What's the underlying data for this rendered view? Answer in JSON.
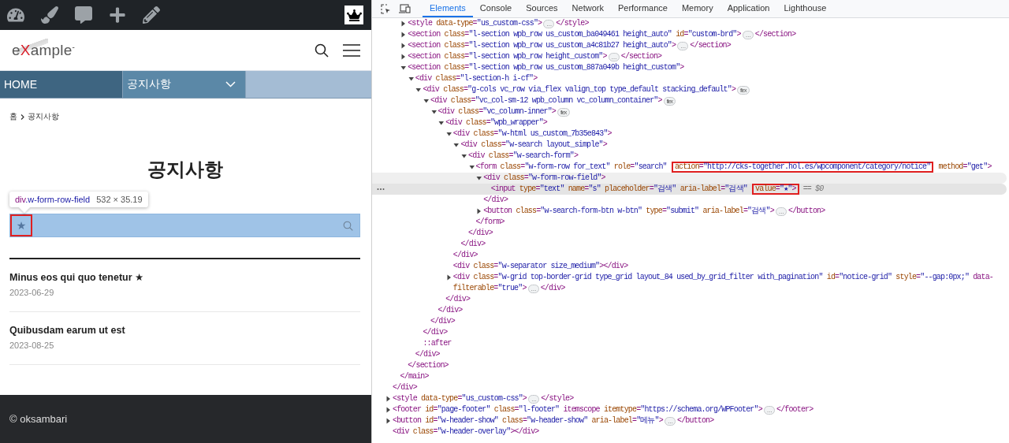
{
  "site": {
    "logo": {
      "before": "e",
      "accent": "X",
      "after": "ample",
      "mark": "-"
    },
    "nav": [
      {
        "label": "HOME",
        "color": "#3e6581",
        "dropdown": false
      },
      {
        "label": "공지사항",
        "color": "#5b88a7",
        "dropdown": true
      }
    ],
    "breadcrumb": [
      "홈",
      "공지사항"
    ],
    "title": "공지사항",
    "inspector_tooltip": {
      "selector": "div.w-form-row-field",
      "size": "532 × 35.19"
    },
    "search": {
      "value": "★",
      "highlighted": true
    },
    "posts": [
      {
        "title": "Minus eos qui quo tenetur ★",
        "date": "2023-06-29"
      },
      {
        "title": "Quibusdam earum ut est",
        "date": "2023-08-25"
      }
    ],
    "footer": "© oksambari"
  },
  "devtools": {
    "tabs": [
      {
        "label": "Elements",
        "selected": true
      },
      {
        "label": "Console",
        "selected": false
      },
      {
        "label": "Sources",
        "selected": false
      },
      {
        "label": "Network",
        "selected": false
      },
      {
        "label": "Performance",
        "selected": false
      },
      {
        "label": "Memory",
        "selected": false
      },
      {
        "label": "Application",
        "selected": false
      },
      {
        "label": "Lighthouse",
        "selected": false
      }
    ],
    "tree": [
      {
        "close": "</div>",
        "children": [
          {
            "close": "</main>",
            "children": [
              {
                "expanded": false,
                "selected": false,
                "hovered": false,
                "open": [
                  {
                    "text": "<style data-type=\"us_custom-css\">",
                    "boxed": false
                  }
                ],
                "badge": "…",
                "close": "</style>"
              },
              {
                "expanded": false,
                "selected": false,
                "hovered": false,
                "open": [
                  {
                    "text": "<section class=\"l-section wpb_row us_custom_ba049461 height_auto\" id=\"custom-brd\">",
                    "boxed": false
                  }
                ],
                "badge": "…",
                "close": "</section>"
              },
              {
                "expanded": false,
                "selected": false,
                "hovered": false,
                "open": [
                  {
                    "text": "<section class=\"l-section wpb_row us_custom_a4c81b27 height_auto\">",
                    "boxed": false
                  }
                ],
                "badge": "…",
                "close": "</section>"
              },
              {
                "expanded": false,
                "selected": false,
                "hovered": false,
                "open": [
                  {
                    "text": "<section class=\"l-section wpb_row height_custom\">",
                    "boxed": false
                  }
                ],
                "badge": "…",
                "close": "</section>"
              },
              {
                "expanded": true,
                "selected": false,
                "hovered": false,
                "open": [
                  {
                    "text": "<section class=\"l-section wpb_row us_custom_887a049b height_custom\">",
                    "boxed": false
                  }
                ],
                "close": "</section>",
                "children": [
                  {
                    "expanded": true,
                    "selected": false,
                    "hovered": false,
                    "open": [
                      {
                        "text": "<div class=\"l-section-h i-cf\">",
                        "boxed": false
                      }
                    ],
                    "close": "</div>",
                    "children": [
                      {
                        "expanded": true,
                        "selected": false,
                        "hovered": false,
                        "open": [
                          {
                            "text": "<div class=\"g-cols vc_row via_flex valign_top type_default stacking_default\">",
                            "boxed": false
                          }
                        ],
                        "badge": "flex",
                        "close": "</div>",
                        "children": [
                          {
                            "expanded": true,
                            "selected": false,
                            "hovered": false,
                            "open": [
                              {
                                "text": "<div class=\"vc_col-sm-12 wpb_column vc_column_container\">",
                                "boxed": false
                              }
                            ],
                            "badge": "flex",
                            "close": "</div>",
                            "children": [
                              {
                                "expanded": true,
                                "selected": false,
                                "hovered": false,
                                "open": [
                                  {
                                    "text": "<div class=\"vc_column-inner\">",
                                    "boxed": false
                                  }
                                ],
                                "badge": "flex",
                                "close": "</div>",
                                "children": [
                                  {
                                    "expanded": true,
                                    "selected": false,
                                    "hovered": false,
                                    "open": [
                                      {
                                        "text": "<div class=\"wpb_wrapper\">",
                                        "boxed": false
                                      }
                                    ],
                                    "close": "</div>",
                                    "children": [
                                      {
                                        "expanded": true,
                                        "selected": false,
                                        "hovered": false,
                                        "open": [
                                          {
                                            "text": "<div class=\"w-html us_custom_7b35e843\">",
                                            "boxed": false
                                          }
                                        ],
                                        "close": "</div>",
                                        "children": [
                                          {
                                            "expanded": true,
                                            "selected": false,
                                            "hovered": false,
                                            "open": [
                                              {
                                                "text": "<div class=\"w-search layout_simple\">",
                                                "boxed": false
                                              }
                                            ],
                                            "close": "</div>",
                                            "children": [
                                              {
                                                "expanded": true,
                                                "selected": false,
                                                "hovered": false,
                                                "open": [
                                                  {
                                                    "text": "<div class=\"w-search-form\">",
                                                    "boxed": false
                                                  }
                                                ],
                                                "close": "</div>",
                                                "children": [
                                                  {
                                                    "expanded": true,
                                                    "selected": false,
                                                    "hovered": false,
                                                    "open": [
                                                      {
                                                        "text": "<form class=\"w-form-row for_text\" role=\"search\" ",
                                                        "boxed": false
                                                      },
                                                      {
                                                        "text": "action=\"http://cks-together.hol.es/wpcomponent/category/notice\"",
                                                        "boxed": true
                                                      },
                                                      {
                                                        "text": " method=\"get\">",
                                                        "boxed": false
                                                      }
                                                    ],
                                                    "close": "</form>",
                                                    "children": [
                                                      {
                                                        "expanded": true,
                                                        "selected": false,
                                                        "hovered": true,
                                                        "open": [
                                                          {
                                                            "text": "<div class=\"w-form-row-field\">",
                                                            "boxed": false
                                                          }
                                                        ],
                                                        "close": "</div>",
                                                        "children": [
                                                          {
                                                            "selected": true,
                                                            "hovered": false,
                                                            "open": [
                                                              {
                                                                "text": "<input type=\"text\" name=\"s\" placeholder=\"검색\" aria-label=\"검색\" ",
                                                                "boxed": false
                                                              },
                                                              {
                                                                "text": "value=\"★\">",
                                                                "boxed": true
                                                              }
                                                            ],
                                                            "console_ref": "== $0"
                                                          }
                                                        ]
                                                      },
                                                      {
                                                        "expanded": false,
                                                        "selected": false,
                                                        "hovered": false,
                                                        "open": [
                                                          {
                                                            "text": "<button class=\"w-search-form-btn w-btn\" type=\"submit\" aria-label=\"검색\">",
                                                            "boxed": false
                                                          }
                                                        ],
                                                        "badge": "…",
                                                        "close": "</button>"
                                                      }
                                                    ]
                                                  }
                                                ]
                                              }
                                            ]
                                          }
                                        ]
                                      },
                                      {
                                        "selected": false,
                                        "hovered": false,
                                        "open": [
                                          {
                                            "text": "<div class=\"w-separator size_medium\">",
                                            "boxed": false
                                          }
                                        ],
                                        "close": "</div>"
                                      },
                                      {
                                        "expanded": false,
                                        "selected": false,
                                        "hovered": false,
                                        "open": [
                                          {
                                            "text": "<div class=\"w-grid top-border-grid type_grid layout_84 used_by_grid_filter with_pagination\" id=\"notice-grid\" style=\"--gap:0px;\" data-",
                                            "boxed": false
                                          },
                                          {
                                            "text": "filterable=\"true\">",
                                            "boxed": false
                                          }
                                        ],
                                        "badge": "…",
                                        "close": "</div>"
                                      }
                                    ]
                                  }
                                ]
                              }
                            ]
                          }
                        ]
                      },
                      {
                        "selected": false,
                        "hovered": false,
                        "open": [
                          {
                            "text": "::after",
                            "boxed": false
                          }
                        ]
                      }
                    ]
                  }
                ]
              }
            ]
          }
        ]
      },
      {
        "expanded": false,
        "selected": false,
        "hovered": false,
        "open": [
          {
            "text": "<style data-type=\"us_custom-css\">",
            "boxed": false
          }
        ],
        "badge": "…",
        "close": "</style>"
      },
      {
        "expanded": false,
        "selected": false,
        "hovered": false,
        "open": [
          {
            "text": "<footer id=\"page-footer\" class=\"l-footer\" itemscope itemtype=\"https://schema.org/WPFooter\">",
            "boxed": false
          }
        ],
        "badge": "…",
        "close": "</footer>"
      },
      {
        "expanded": false,
        "selected": false,
        "hovered": false,
        "open": [
          {
            "text": "<button id=\"w-header-show\" class=\"w-header-show\" aria-label=\"메뉴\">",
            "boxed": false
          }
        ],
        "badge": "…",
        "close": "</button>"
      },
      {
        "selected": false,
        "hovered": false,
        "open": [
          {
            "text": "<div class=\"w-header-overlay\">",
            "boxed": false
          }
        ],
        "close": "</div>"
      }
    ]
  }
}
